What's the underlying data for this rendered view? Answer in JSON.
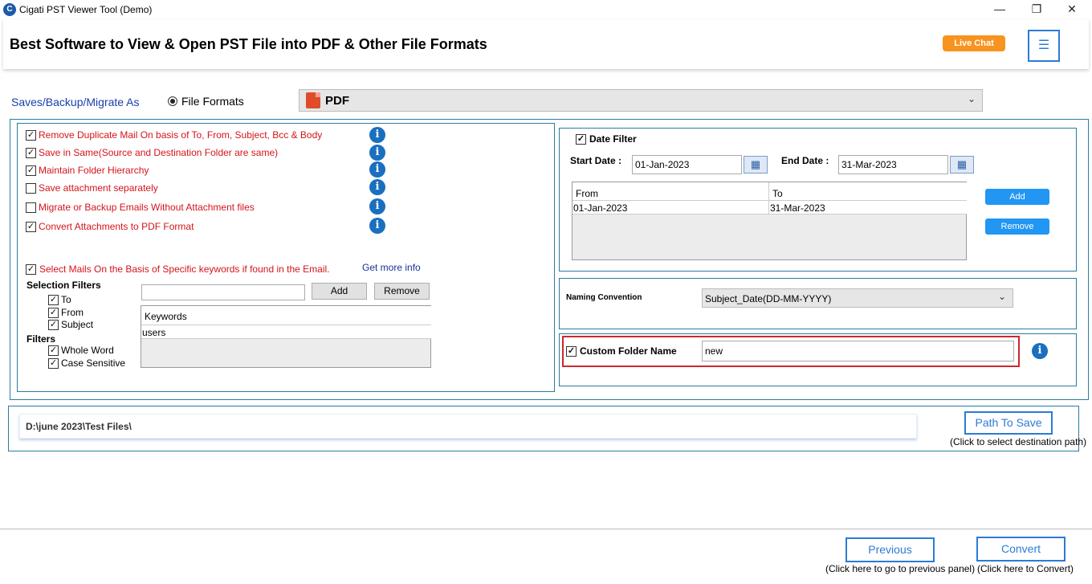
{
  "window": {
    "title": "Cigati PST Viewer Tool (Demo)",
    "minimize": "—",
    "maximize": "❐",
    "close": "✕"
  },
  "header": {
    "title": "Best Software to View & Open PST File into PDF & Other File Formats",
    "live_chat": "Live Chat",
    "menu_icon": "hamburger-icon"
  },
  "save_as": {
    "label": "Saves/Backup/Migrate As",
    "radio_label": "File Formats",
    "format_selected": "PDF"
  },
  "options": [
    {
      "label": "Remove Duplicate Mail On basis of To, From, Subject, Bcc & Body",
      "checked": true
    },
    {
      "label": "Save in Same(Source and Destination Folder are same)",
      "checked": true
    },
    {
      "label": "Maintain Folder Hierarchy",
      "checked": true
    },
    {
      "label": "Save attachment separately",
      "checked": false
    },
    {
      "label": "Migrate or Backup Emails Without Attachment files",
      "checked": false
    },
    {
      "label": "Convert Attachments to PDF Format",
      "checked": true
    }
  ],
  "keywords_section": {
    "checkbox_label": "Select Mails On the Basis of Specific keywords if found in the Email.",
    "get_more_info": "Get more info",
    "selection_filters_label": "Selection Filters",
    "selection_filters": [
      "To",
      "From",
      "Subject"
    ],
    "filters_label": "Filters",
    "filters": [
      "Whole Word",
      "Case Sensitive"
    ],
    "keyword_input": "",
    "add_label": "Add",
    "remove_label": "Remove",
    "table_header": "Keywords",
    "rows": [
      "users"
    ]
  },
  "date_filter": {
    "label": "Date Filter",
    "start_label": "Start Date :",
    "start_value": "01-Jan-2023",
    "end_label": "End Date :",
    "end_value": "31-Mar-2023",
    "col_from": "From",
    "col_to": "To",
    "rows": [
      {
        "from": "01-Jan-2023",
        "to": "31-Mar-2023"
      }
    ],
    "add_label": "Add",
    "remove_label": "Remove"
  },
  "naming": {
    "label": "Naming Convention",
    "value": "Subject_Date(DD-MM-YYYY)"
  },
  "custom_folder": {
    "label": "Custom Folder Name",
    "value": "new"
  },
  "path": {
    "value": "D:\\june 2023\\Test Files\\",
    "button": "Path To Save",
    "hint": "(Click to select destination path)"
  },
  "footer": {
    "previous": "Previous",
    "previous_hint": "(Click here to go to previous panel)",
    "convert": "Convert",
    "convert_hint": "(Click here to Convert)"
  },
  "colors": {
    "accent": "#2b7bd6",
    "option_text": "#d4141a",
    "live_chat": "#f7931e",
    "highlight": "#d0262f"
  }
}
